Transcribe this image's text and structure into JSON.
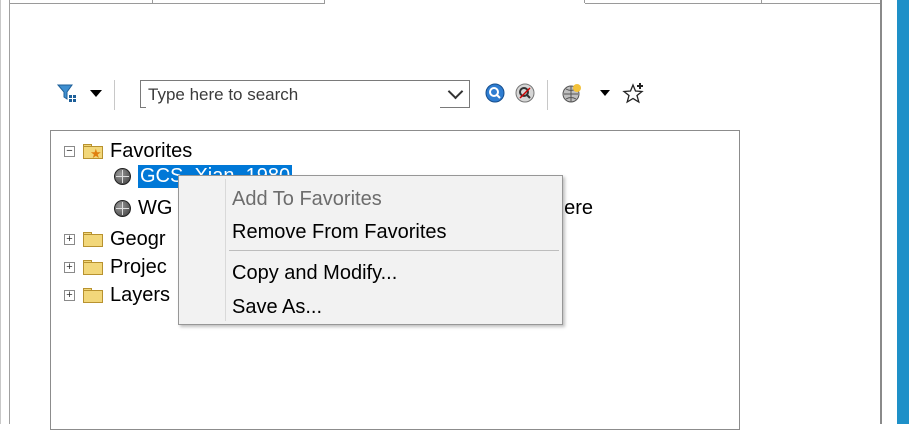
{
  "toolbar": {
    "search_placeholder": "Type here to search",
    "icons": [
      "filter-icon",
      "dropdown-arrow-icon",
      "search-icon",
      "clear-search-icon",
      "globe-add-icon",
      "favorite-add-icon"
    ]
  },
  "tree": {
    "items": [
      {
        "label": "Favorites",
        "expanded": true
      },
      {
        "label": "GCS_Xian_1980",
        "selected": true
      },
      {
        "label": "WG",
        "tail": "here"
      },
      {
        "label": "Geogr"
      },
      {
        "label": "Projec"
      },
      {
        "label": "Layers"
      }
    ]
  },
  "context_menu": {
    "items": [
      {
        "label": "Add To Favorites",
        "enabled": false
      },
      {
        "label": "Remove From Favorites",
        "enabled": true
      },
      {
        "label": "Copy and Modify...",
        "enabled": true
      },
      {
        "label": "Save As...",
        "enabled": true
      }
    ]
  },
  "colors": {
    "selection": "#0078d7",
    "window_edge": "#1e90c8",
    "menu_bg": "#f2f2f2"
  }
}
